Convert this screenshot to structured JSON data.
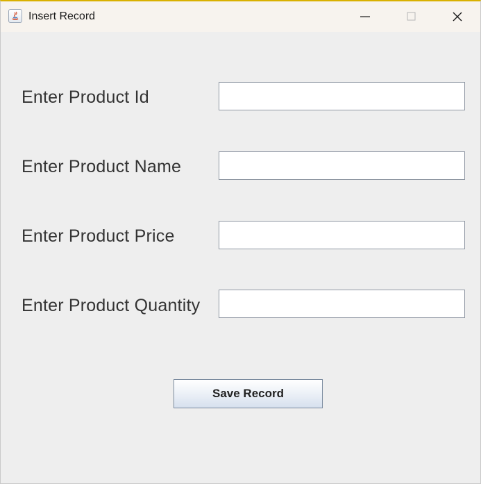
{
  "window": {
    "title": "Insert Record",
    "controls": {
      "minimize": "minimize-icon",
      "maximize": "maximize-icon",
      "close": "close-icon"
    },
    "app_icon": "java-icon"
  },
  "form": {
    "fields": [
      {
        "label": "Enter Product Id",
        "value": ""
      },
      {
        "label": "Enter Product Name",
        "value": ""
      },
      {
        "label": "Enter Product Price",
        "value": ""
      },
      {
        "label": "Enter Product Quantity",
        "value": ""
      }
    ],
    "save_label": "Save Record"
  },
  "colors": {
    "window_bg": "#eeeeee",
    "titlebar_bg": "#f7f3ee",
    "accent_border": "#d9b000"
  }
}
